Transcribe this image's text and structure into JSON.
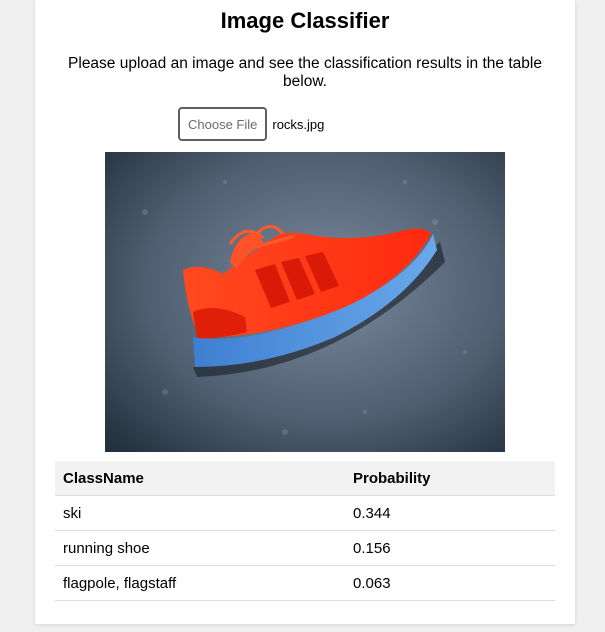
{
  "page": {
    "title": "Image Classifier",
    "intro": "Please upload an image and see the classification results in the table below."
  },
  "upload": {
    "button_label": "Choose File",
    "file_name": "rocks.jpg"
  },
  "preview": {
    "subject": "red running shoe with blue sole on grey concrete"
  },
  "results": {
    "headers": [
      "ClassName",
      "Probability"
    ],
    "rows": [
      {
        "class_name": "ski",
        "probability": "0.344"
      },
      {
        "class_name": "running shoe",
        "probability": "0.156"
      },
      {
        "class_name": "flagpole, flagstaff",
        "probability": "0.063"
      }
    ]
  },
  "colors": {
    "background": "#f0f0f0",
    "card": "#ffffff",
    "table_header": "#f2f2f2",
    "row_border": "#dddddd",
    "shoe_upper": "#ff3b1a",
    "shoe_sole": "#4a86d4"
  }
}
